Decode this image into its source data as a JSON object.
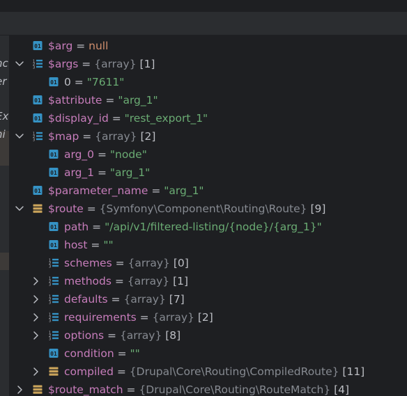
{
  "left_panel": {
    "fragments": [
      "nc",
      "er",
      "Ex",
      "ni"
    ]
  },
  "variables": [
    {
      "depth": 0,
      "expander": "none",
      "icon": "field",
      "name": "$arg",
      "value": "null",
      "value_kind": "keyword"
    },
    {
      "depth": 0,
      "expander": "expanded",
      "icon": "array",
      "name": "$args",
      "value": "{array}",
      "value_kind": "type",
      "count": "[1]"
    },
    {
      "depth": 1,
      "expander": "none",
      "icon": "field",
      "name": "0",
      "plain_name": true,
      "value": "\"7611\"",
      "value_kind": "string"
    },
    {
      "depth": 0,
      "expander": "none",
      "icon": "field",
      "name": "$attribute",
      "value": "\"arg_1\"",
      "value_kind": "string"
    },
    {
      "depth": 0,
      "expander": "none",
      "icon": "field",
      "name": "$display_id",
      "value": "\"rest_export_1\"",
      "value_kind": "string"
    },
    {
      "depth": 0,
      "expander": "expanded",
      "icon": "array",
      "name": "$map",
      "value": "{array}",
      "value_kind": "type",
      "count": "[2]"
    },
    {
      "depth": 1,
      "expander": "none",
      "icon": "field",
      "name": "arg_0",
      "value": "\"node\"",
      "value_kind": "string"
    },
    {
      "depth": 1,
      "expander": "none",
      "icon": "field",
      "name": "arg_1",
      "value": "\"arg_1\"",
      "value_kind": "string"
    },
    {
      "depth": 0,
      "expander": "none",
      "icon": "field",
      "name": "$parameter_name",
      "value": "\"arg_1\"",
      "value_kind": "string"
    },
    {
      "depth": 0,
      "expander": "expanded",
      "icon": "object",
      "name": "$route",
      "value": "{Symfony\\Component\\Routing\\Route}",
      "value_kind": "type",
      "count": "[9]"
    },
    {
      "depth": 1,
      "expander": "none",
      "icon": "field",
      "name": "path",
      "value": "\"/api/v1/filtered-listing/{node}/{arg_1}\"",
      "value_kind": "string"
    },
    {
      "depth": 1,
      "expander": "none",
      "icon": "field",
      "name": "host",
      "value": "\"\"",
      "value_kind": "string"
    },
    {
      "depth": 1,
      "expander": "none",
      "icon": "array",
      "name": "schemes",
      "value": "{array}",
      "value_kind": "type",
      "count": "[0]"
    },
    {
      "depth": 1,
      "expander": "collapsed",
      "icon": "array",
      "name": "methods",
      "value": "{array}",
      "value_kind": "type",
      "count": "[1]"
    },
    {
      "depth": 1,
      "expander": "collapsed",
      "icon": "array",
      "name": "defaults",
      "value": "{array}",
      "value_kind": "type",
      "count": "[7]"
    },
    {
      "depth": 1,
      "expander": "collapsed",
      "icon": "array",
      "name": "requirements",
      "value": "{array}",
      "value_kind": "type",
      "count": "[2]"
    },
    {
      "depth": 1,
      "expander": "collapsed",
      "icon": "array",
      "name": "options",
      "value": "{array}",
      "value_kind": "type",
      "count": "[8]"
    },
    {
      "depth": 1,
      "expander": "none",
      "icon": "field",
      "name": "condition",
      "value": "\"\"",
      "value_kind": "string"
    },
    {
      "depth": 1,
      "expander": "collapsed",
      "icon": "object",
      "name": "compiled",
      "value": "{Drupal\\Core\\Routing\\CompiledRoute}",
      "value_kind": "type",
      "count": "[11]"
    },
    {
      "depth": 0,
      "expander": "collapsed",
      "icon": "object",
      "name": "$route_match",
      "value": "{Drupal\\Core\\Routing\\RouteMatch}",
      "value_kind": "type",
      "count": "[4]"
    }
  ],
  "colors": {
    "editor_bg": "#1e1f22",
    "panel_bg": "#2b2d30",
    "variable_name": "#c77dbb",
    "string_value": "#6aab73",
    "keyword_value": "#cf8e6d",
    "type_value": "#868a91",
    "default_text": "#bcbec4",
    "field_icon": "#3592c4",
    "object_icon": "#c9a35a"
  }
}
